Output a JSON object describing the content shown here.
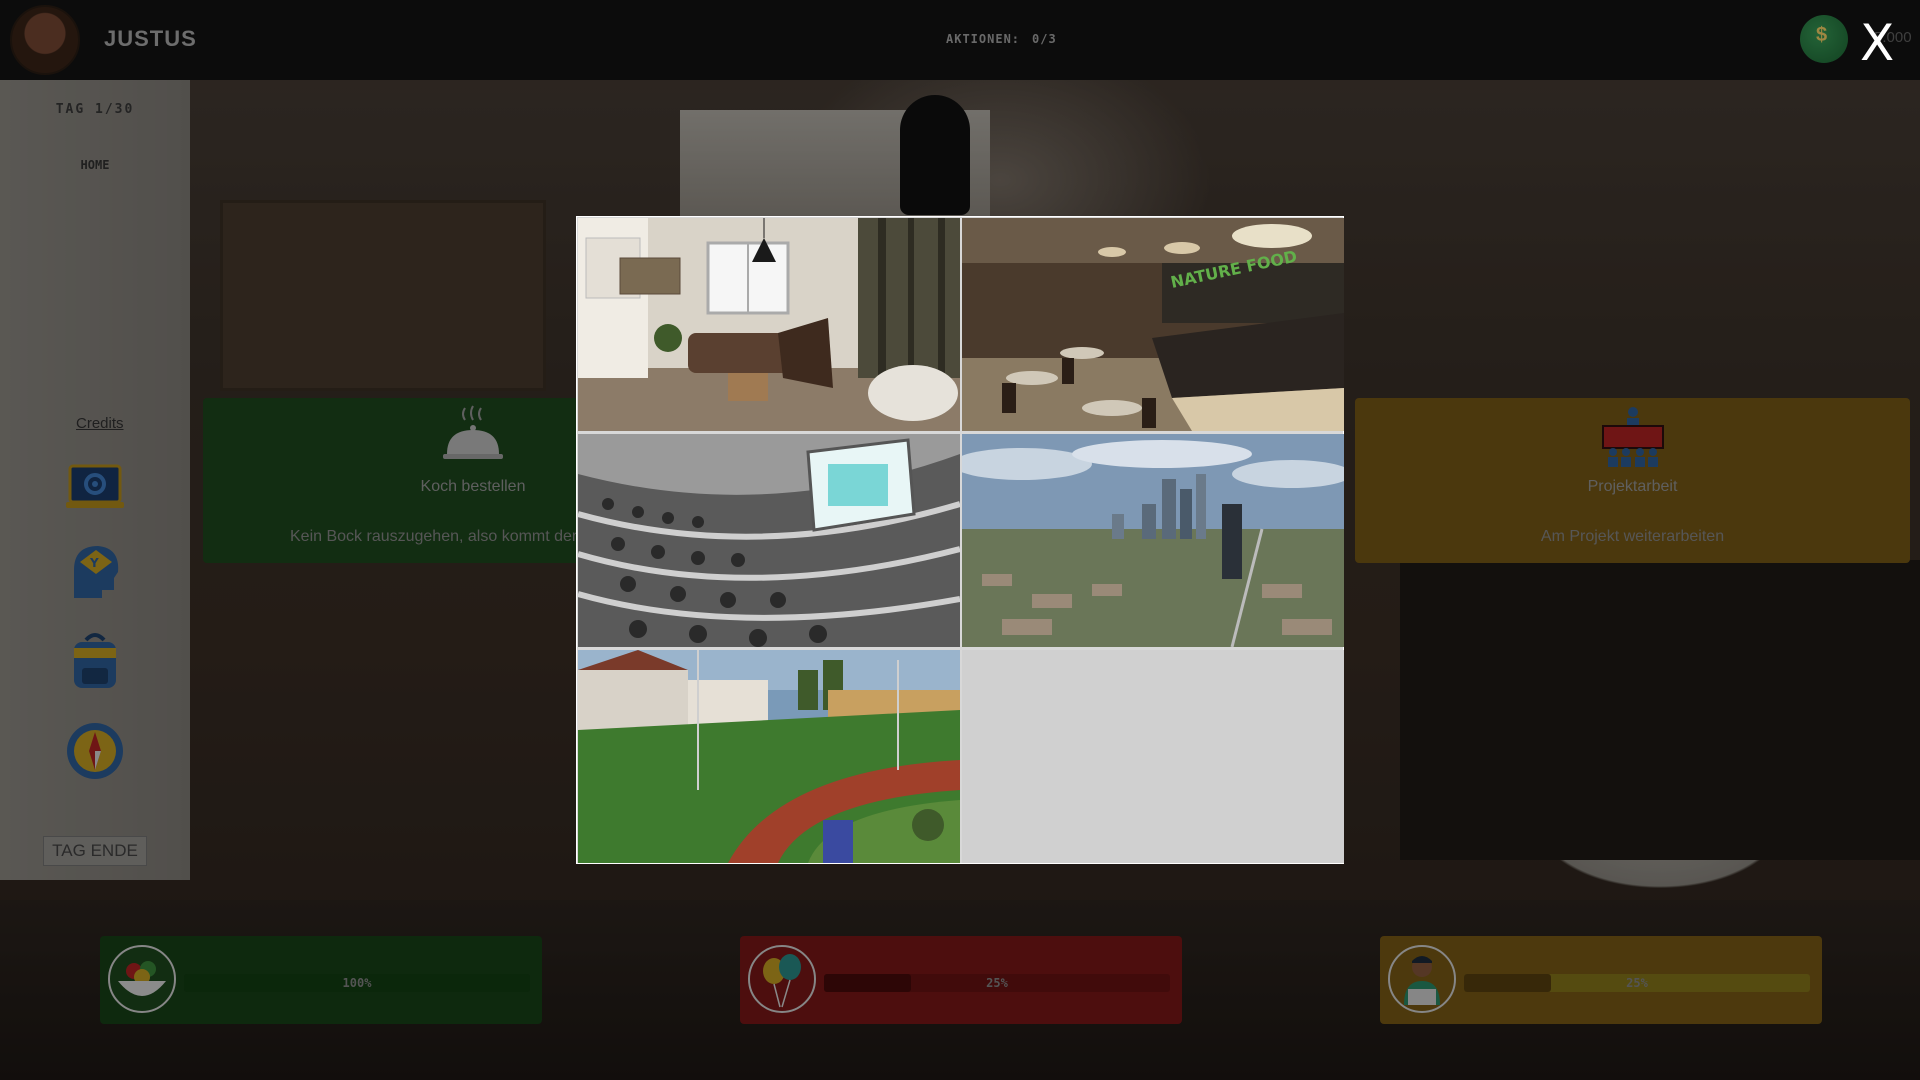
{
  "header": {
    "player_name": "JUSTUS",
    "actions_label": "AKTIONEN:",
    "actions_value": "0/3",
    "money_value": "5.000",
    "close_label": "X"
  },
  "sidebar": {
    "day_label": "TAG 1/30",
    "home_label": "HOME",
    "credits_label": "Credits",
    "icons": [
      "settings-laptop-icon",
      "head-signpost-icon",
      "backpack-icon",
      "compass-icon"
    ],
    "end_day_label": "TAG ENDE"
  },
  "cards": [
    {
      "title": "Koch bestellen",
      "description": "Kein Bock rauszugehen, also kommt der",
      "icon": "cloche-icon",
      "color": "#1d4a1e"
    },
    {
      "title": "Projektarbeit",
      "description": "Am Projekt weiterarbeiten",
      "icon": "team-presentation-icon",
      "color": "#7a5b16"
    }
  ],
  "location_modal": {
    "tiles": [
      {
        "name": "living-room",
        "icon": "living-room-photo"
      },
      {
        "name": "food-court",
        "icon": "food-court-photo",
        "sign_text": "NATURE FOOD"
      },
      {
        "name": "lecture-hall",
        "icon": "lecture-hall-photo"
      },
      {
        "name": "city-skyline",
        "icon": "city-skyline-photo"
      },
      {
        "name": "sports-field",
        "icon": "sports-field-photo"
      }
    ]
  },
  "status_bars": [
    {
      "name": "food",
      "label": "100%",
      "value": 1.0,
      "icon": "food-bowl-icon",
      "color": "#174318"
    },
    {
      "name": "fun",
      "label": "25%",
      "value": 0.25,
      "icon": "balloons-icon",
      "color": "#7c1717"
    },
    {
      "name": "work",
      "label": "25%",
      "value": 0.25,
      "icon": "worker-laptop-icon",
      "color": "#7c5d15"
    }
  ]
}
